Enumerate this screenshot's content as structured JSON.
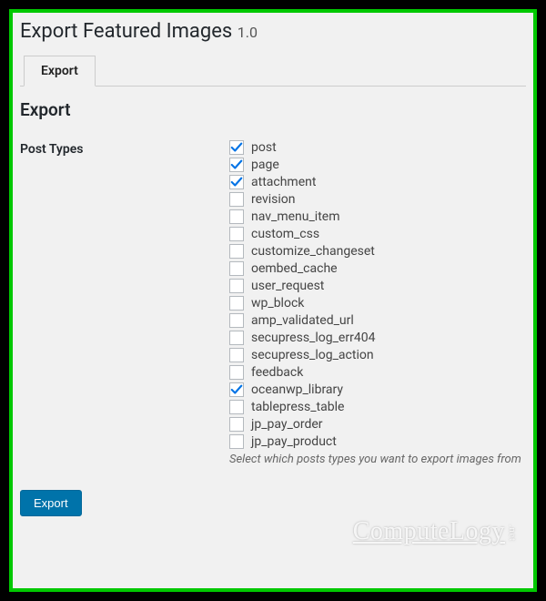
{
  "pageTitle": "Export Featured Images",
  "version": "1.0",
  "tabs": [
    {
      "label": "Export"
    }
  ],
  "sectionHeading": "Export",
  "fieldLabel": "Post Types",
  "postTypes": [
    {
      "label": "post",
      "checked": true
    },
    {
      "label": "page",
      "checked": true
    },
    {
      "label": "attachment",
      "checked": true
    },
    {
      "label": "revision",
      "checked": false
    },
    {
      "label": "nav_menu_item",
      "checked": false
    },
    {
      "label": "custom_css",
      "checked": false
    },
    {
      "label": "customize_changeset",
      "checked": false
    },
    {
      "label": "oembed_cache",
      "checked": false
    },
    {
      "label": "user_request",
      "checked": false
    },
    {
      "label": "wp_block",
      "checked": false
    },
    {
      "label": "amp_validated_url",
      "checked": false
    },
    {
      "label": "secupress_log_err404",
      "checked": false
    },
    {
      "label": "secupress_log_action",
      "checked": false
    },
    {
      "label": "feedback",
      "checked": false
    },
    {
      "label": "oceanwp_library",
      "checked": true
    },
    {
      "label": "tablepress_table",
      "checked": false
    },
    {
      "label": "jp_pay_order",
      "checked": false
    },
    {
      "label": "jp_pay_product",
      "checked": false
    }
  ],
  "helpText": "Select which posts types you want to export images from",
  "submitLabel": "Export",
  "watermark": "ComputeLogy",
  "watermarkSuffix": ".net"
}
